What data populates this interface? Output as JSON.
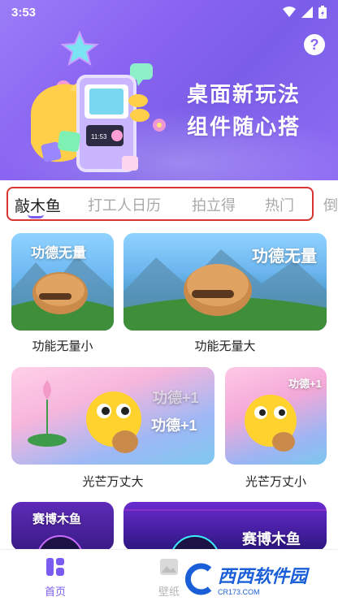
{
  "status_bar": {
    "time": "3:53"
  },
  "hero": {
    "title_line1": "桌面新玩法",
    "title_line2": "组件随心搭",
    "widget_time": "11:53",
    "help_label": "?"
  },
  "tabs": [
    {
      "label": "敲木鱼",
      "active": true
    },
    {
      "label": "打工人日历",
      "active": false
    },
    {
      "label": "拍立得",
      "active": false
    },
    {
      "label": "热门",
      "active": false
    },
    {
      "label": "倒",
      "active": false
    }
  ],
  "cards": [
    {
      "overlay": "功德无量",
      "label": "功能无量小"
    },
    {
      "overlay": "功德无量",
      "label": "功能无量大"
    },
    {
      "overlay": "功德+1",
      "overlay_faded": "功德+1",
      "label": "光芒万丈大"
    },
    {
      "overlay": "功德+1",
      "label": "光芒万丈小"
    },
    {
      "overlay": "赛博木鱼"
    },
    {
      "overlay": "赛博木鱼"
    }
  ],
  "nav": {
    "home_label": "首页",
    "wallpaper_label": "壁纸"
  },
  "watermark": {
    "brand": "西西软件园",
    "domain": "CR173.COM"
  },
  "colors": {
    "accent": "#8a64f2",
    "tab_outline": "#d9342f",
    "active_nav": "#7a5cf0"
  }
}
